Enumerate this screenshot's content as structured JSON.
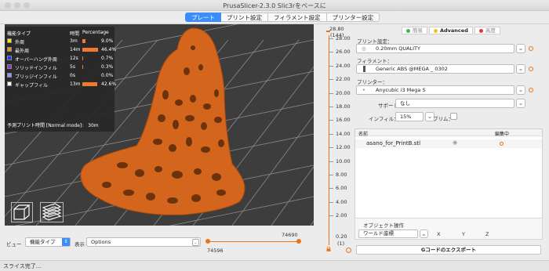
{
  "window": {
    "title": "PrusaSlicer-2.3.0 Slic3rをベースに"
  },
  "tabs": [
    {
      "label": "プレート",
      "active": true
    },
    {
      "label": "プリント設定",
      "active": false
    },
    {
      "label": "フィラメント設定",
      "active": false
    },
    {
      "label": "プリンター設定",
      "active": false
    }
  ],
  "legend": {
    "col_type": "機能タイプ",
    "col_time": "時間",
    "col_pct": "Percentage",
    "rows": [
      {
        "name": "外周",
        "time": "3m",
        "pct_label": "9.0%",
        "pct": 9.0,
        "color": "#f5e61c"
      },
      {
        "name": "最外周",
        "time": "14m",
        "pct_label": "46.4%",
        "pct": 46.4,
        "color": "#ff8a1e"
      },
      {
        "name": "オーバーハング外周",
        "time": "12s",
        "pct_label": "0.7%",
        "pct": 0.7,
        "color": "#1a3cf0"
      },
      {
        "name": "ソリッドインフィル",
        "time": "5s",
        "pct_label": "0.3%",
        "pct": 0.3,
        "color": "#9b2fcf"
      },
      {
        "name": "ブリッジインフィル",
        "time": "0s",
        "pct_label": "0.0%",
        "pct": 0.0,
        "color": "#8e9cff"
      },
      {
        "name": "ギャップフィル",
        "time": "13m",
        "pct_label": "42.6%",
        "pct": 42.6,
        "color": "#ffffff"
      }
    ],
    "estimate_label": "予測プリント時間 [Normal mode]:",
    "estimate_value": "30m"
  },
  "vslider": {
    "top_value": "28.80",
    "top_layer": "(144)",
    "ticks": [
      "28.00",
      "26.00",
      "24.00",
      "22.00",
      "20.00",
      "18.00",
      "16.00",
      "14.00",
      "12.00",
      "10.00",
      "8.00",
      "6.00",
      "4.00",
      "2.00"
    ],
    "bottom_value": "0.20",
    "bottom_layer": "(1)"
  },
  "bottom": {
    "view_label": "ビュー",
    "view_value": "機能タイプ",
    "show_label": "表示",
    "show_value": "Options",
    "hslider_right": "74690",
    "hslider_left": "74596"
  },
  "panel": {
    "modes": [
      {
        "label": "簡易",
        "color": "#4caf50",
        "bold": false
      },
      {
        "label": "Advanced",
        "color": "#f5c518",
        "bold": true
      },
      {
        "label": "高度",
        "color": "#e53935",
        "bold": false
      }
    ],
    "print_label": "プリント設定：",
    "print_value": "0.20mm QUALITY",
    "filament_label": "フィラメント：",
    "filament_value": "Generic ABS @MEGA _ 0302",
    "printer_label": "プリンター：",
    "printer_value": "Anycubic i3 Mega S",
    "support_label": "サポート：",
    "support_value": "なし",
    "infill_label": "インフィル：",
    "infill_value": "15%",
    "brim_label": "ブリム：",
    "list_col_name": "名前",
    "list_col_edit": "編集中",
    "object_name": "asano_for_PrintB.stl",
    "obj_ops_label": "オブジェクト操作",
    "coord_value": "ワールド座標",
    "axis_x": "X",
    "axis_y": "Y",
    "axis_z": "Z",
    "export_label": "Gコードのエクスポート"
  },
  "status": {
    "text": "スライス完了..."
  }
}
